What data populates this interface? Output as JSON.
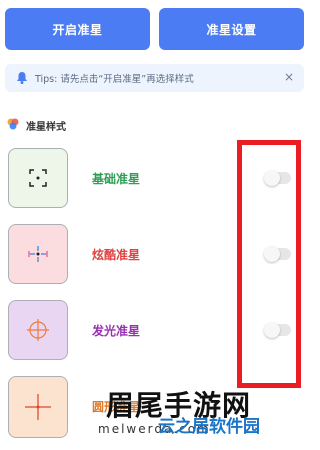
{
  "buttons": {
    "start": "开启准星",
    "settings": "准星设置"
  },
  "tip": {
    "text": "Tips: 请先点击“开启准星”再选择样式",
    "close": "×"
  },
  "section": {
    "title": "准星样式"
  },
  "styles": [
    {
      "label": "基础准星",
      "color": "#2f9e55",
      "bg": "#eef6ea",
      "enabled": false
    },
    {
      "label": "炫酷准星",
      "color": "#e04141",
      "bg": "#fbdde0",
      "enabled": false
    },
    {
      "label": "发光准星",
      "color": "#9a2fb0",
      "bg": "#e9d6f3",
      "enabled": false
    },
    {
      "label": "圆形准星",
      "color": "#e07b2b",
      "bg": "#fbe3cf"
    }
  ],
  "watermark": {
    "main": "眉尾手游网",
    "latin": "melwerda.com",
    "secondary": "云之居软件园"
  }
}
